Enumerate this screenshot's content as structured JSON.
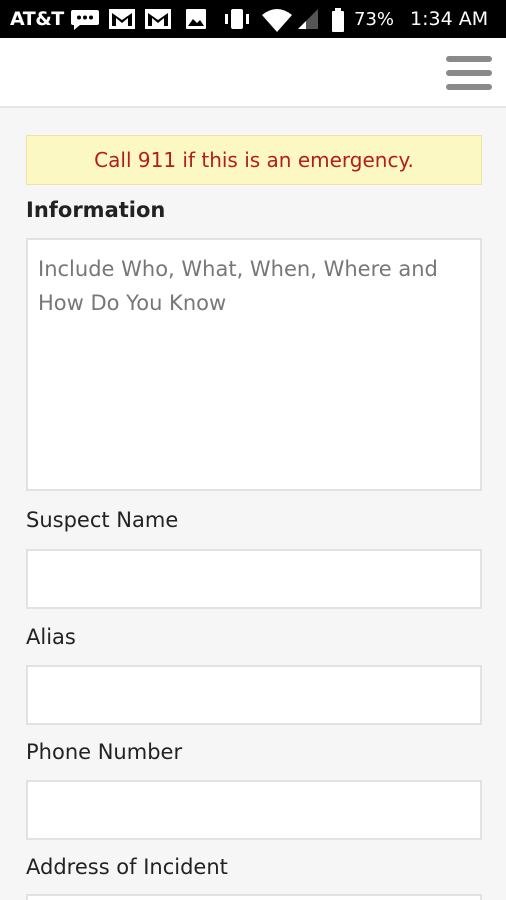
{
  "status_bar": {
    "carrier": "AT&T",
    "battery": "73%",
    "time": "1:34 AM"
  },
  "alert": {
    "text": "Call 911 if this is an emergency."
  },
  "form": {
    "information_label": "Information",
    "information_placeholder": "Include Who, What, When, Where and How Do You Know",
    "suspect_name_label": "Suspect Name",
    "alias_label": "Alias",
    "phone_label": "Phone Number",
    "address_label": "Address of Incident"
  }
}
